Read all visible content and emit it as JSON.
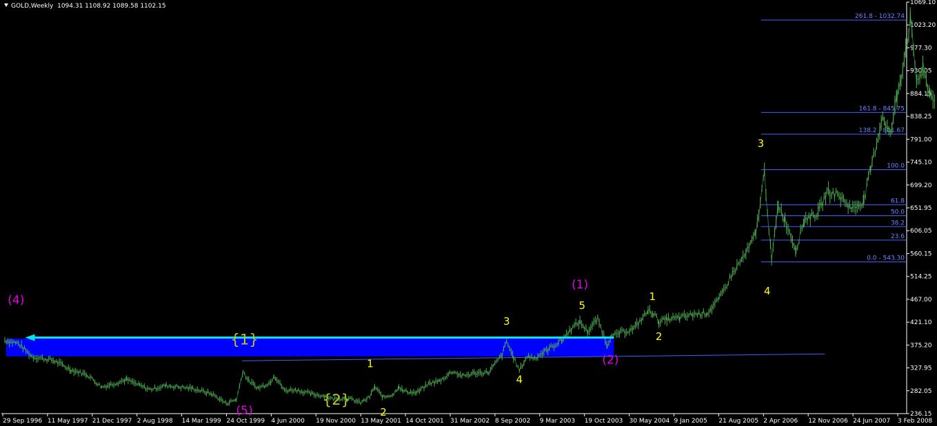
{
  "header": {
    "symbol": "GOLD,Weekly",
    "ohlc": "1094.31 1108.92 1089.58 1102.15"
  },
  "colors": {
    "background": "#000000",
    "price": "#4caf50",
    "fib": "#4a5cff",
    "band": "#0000ff",
    "arrow": "#00e5e5",
    "wave_yellow": "#ffff00",
    "wave_magenta": "#e000e0",
    "wave_olive": "#b5c832"
  },
  "chart_data": {
    "type": "line",
    "title": "",
    "xlabel": "",
    "ylabel": "",
    "ylim": [
      236.15,
      1069.1
    ],
    "y_ticks": [
      "1069.10",
      "1023.20",
      "977.30",
      "930.05",
      "884.15",
      "838.25",
      "791.00",
      "745.10",
      "699.20",
      "651.95",
      "606.05",
      "560.15",
      "514.25",
      "467.00",
      "421.10",
      "375.20",
      "327.95",
      "282.05",
      "236.15"
    ],
    "x_ticks": [
      "29 Sep 1996",
      "11 May 1997",
      "21 Dec 1997",
      "2 Aug 1998",
      "14 Mar 1999",
      "24 Oct 1999",
      "4 Jun 2000",
      "19 Nov 2000",
      "13 May 2001",
      "14 Oct 2001",
      "31 Mar 2002",
      "8 Sep 2002",
      "9 Mar 2003",
      "19 Oct 2003",
      "30 May 2004",
      "9 Jan 2005",
      "21 Aug 2005",
      "2 Apr 2006",
      "12 Nov 2006",
      "24 Jun 2007",
      "3 Feb 2008"
    ],
    "series": [
      {
        "points": [
          [
            "1996-09-29",
            385
          ],
          [
            "1996-12-01",
            378
          ],
          [
            "1997-02-01",
            352
          ],
          [
            "1997-05-11",
            344
          ],
          [
            "1997-08-01",
            325
          ],
          [
            "1997-10-15",
            315
          ],
          [
            "1997-12-21",
            290
          ],
          [
            "1998-02-15",
            297
          ],
          [
            "1998-04-15",
            305
          ],
          [
            "1998-06-15",
            293
          ],
          [
            "1998-08-02",
            285
          ],
          [
            "1998-10-15",
            293
          ],
          [
            "1998-12-15",
            290
          ],
          [
            "1999-02-15",
            287
          ],
          [
            "1999-05-15",
            276
          ],
          [
            "1999-07-20",
            257
          ],
          [
            "1999-09-05",
            265
          ],
          [
            "1999-10-05",
            322
          ],
          [
            "1999-11-01",
            302
          ],
          [
            "1999-12-15",
            288
          ],
          [
            "2000-02-10",
            300
          ],
          [
            "2000-02-25",
            314
          ],
          [
            "2000-04-15",
            283
          ],
          [
            "2000-06-04",
            285
          ],
          [
            "2000-08-15",
            276
          ],
          [
            "2000-10-15",
            272
          ],
          [
            "2000-11-19",
            266
          ],
          [
            "2001-01-15",
            268
          ],
          [
            "2001-02-25",
            264
          ],
          [
            "2001-04-01",
            258
          ],
          [
            "2001-05-13",
            270
          ],
          [
            "2001-06-05",
            290
          ],
          [
            "2001-07-15",
            269
          ],
          [
            "2001-09-01",
            276
          ],
          [
            "2001-09-25",
            292
          ],
          [
            "2001-10-14",
            282
          ],
          [
            "2001-12-15",
            278
          ],
          [
            "2002-02-15",
            298
          ],
          [
            "2002-03-31",
            302
          ],
          [
            "2002-06-01",
            322
          ],
          [
            "2002-07-15",
            312
          ],
          [
            "2002-09-08",
            318
          ],
          [
            "2002-11-15",
            320
          ],
          [
            "2003-01-15",
            355
          ],
          [
            "2003-02-05",
            382
          ],
          [
            "2003-03-09",
            350
          ],
          [
            "2003-04-05",
            323
          ],
          [
            "2003-05-10",
            352
          ],
          [
            "2003-06-15",
            349
          ],
          [
            "2003-08-01",
            362
          ],
          [
            "2003-10-19",
            385
          ],
          [
            "2003-12-01",
            408
          ],
          [
            "2004-01-10",
            422
          ],
          [
            "2004-02-15",
            402
          ],
          [
            "2004-04-01",
            428
          ],
          [
            "2004-05-15",
            376
          ],
          [
            "2004-05-30",
            390
          ],
          [
            "2004-07-15",
            400
          ],
          [
            "2004-09-15",
            408
          ],
          [
            "2004-11-20",
            444
          ],
          [
            "2004-12-15",
            440
          ],
          [
            "2005-01-09",
            422
          ],
          [
            "2005-02-15",
            427
          ],
          [
            "2005-04-15",
            430
          ],
          [
            "2005-06-15",
            437
          ],
          [
            "2005-08-21",
            440
          ],
          [
            "2005-10-15",
            468
          ],
          [
            "2005-12-15",
            520
          ],
          [
            "2006-02-15",
            560
          ],
          [
            "2006-04-02",
            600
          ],
          [
            "2006-05-12",
            725
          ],
          [
            "2006-06-14",
            545
          ],
          [
            "2006-07-15",
            660
          ],
          [
            "2006-08-15",
            628
          ],
          [
            "2006-10-05",
            568
          ],
          [
            "2006-11-12",
            630
          ],
          [
            "2007-01-15",
            642
          ],
          [
            "2007-02-25",
            685
          ],
          [
            "2007-04-15",
            680
          ],
          [
            "2007-06-24",
            650
          ],
          [
            "2007-08-15",
            668
          ],
          [
            "2007-09-15",
            730
          ],
          [
            "2007-11-10",
            840
          ],
          [
            "2007-12-15",
            798
          ],
          [
            "2008-01-15",
            880
          ],
          [
            "2008-02-03",
            920
          ],
          [
            "2008-03-17",
            1032
          ],
          [
            "2008-04-15",
            910
          ],
          [
            "2008-05-15",
            930
          ],
          [
            "2008-06-15",
            884
          ],
          [
            "2008-07-10",
            875
          ]
        ]
      }
    ],
    "fib_levels": [
      {
        "label": "261.8 - 1032.74",
        "value": 1032.74
      },
      {
        "label": "161.8 - 845.75",
        "value": 845.75
      },
      {
        "label": "138.2 - 801.67",
        "value": 801.67
      },
      {
        "label": "100.0",
        "value": 730.0
      },
      {
        "label": "61.8",
        "value": 658.64
      },
      {
        "label": "50.0",
        "value": 636.65
      },
      {
        "label": "38.2",
        "value": 614.62
      },
      {
        "label": "23.6",
        "value": 587.35
      },
      {
        "label": "0.0 - 543.30",
        "value": 543.3
      }
    ],
    "fib_x_start": "2006-04-26",
    "annotations": {
      "band": {
        "x_start": "1996-09-29",
        "x_end": "2004-06-15",
        "y_low": 352,
        "y_high": 388
      },
      "arrow": {
        "x_from": "2004-06-15",
        "x_to": "1997-01-01",
        "y": 390
      },
      "trendline": {
        "x1": "1999-10-01",
        "y1": 343,
        "x2": "2007-02-15",
        "y2": 357
      },
      "labels": [
        {
          "text": "(4)",
          "x": "1996-11-20",
          "y": 458,
          "color": "magenta",
          "size": 17
        },
        {
          "text": "{1}",
          "x": "1999-10-12",
          "y": 376,
          "color": "olive",
          "size": 21
        },
        {
          "text": "(5)",
          "x": "1999-10-12",
          "y": 235,
          "color": "magenta",
          "size": 17
        },
        {
          "text": "{2}",
          "x": "2000-12-10",
          "y": 254,
          "color": "olive",
          "size": 21
        },
        {
          "text": "1",
          "x": "2001-05-15",
          "y": 330,
          "color": "yellow",
          "size": 15
        },
        {
          "text": "2",
          "x": "2001-07-15",
          "y": 232,
          "color": "yellow",
          "size": 15
        },
        {
          "text": "3",
          "x": "2003-02-05",
          "y": 416,
          "color": "yellow",
          "size": 15
        },
        {
          "text": "4",
          "x": "2003-04-05",
          "y": 298,
          "color": "yellow",
          "size": 15
        },
        {
          "text": "(1)",
          "x": "2004-01-10",
          "y": 490,
          "color": "magenta",
          "size": 17
        },
        {
          "text": "5",
          "x": "2004-01-20",
          "y": 448,
          "color": "yellow",
          "size": 15
        },
        {
          "text": "(2)",
          "x": "2004-05-30",
          "y": 337,
          "color": "magenta",
          "size": 17
        },
        {
          "text": "1",
          "x": "2004-12-10",
          "y": 466,
          "color": "yellow",
          "size": 15
        },
        {
          "text": "2",
          "x": "2005-01-09",
          "y": 385,
          "color": "yellow",
          "size": 15
        },
        {
          "text": "3",
          "x": "2006-04-25",
          "y": 776,
          "color": "yellow",
          "size": 15
        },
        {
          "text": "4",
          "x": "2006-05-25",
          "y": 477,
          "color": "yellow",
          "size": 15
        }
      ]
    }
  }
}
